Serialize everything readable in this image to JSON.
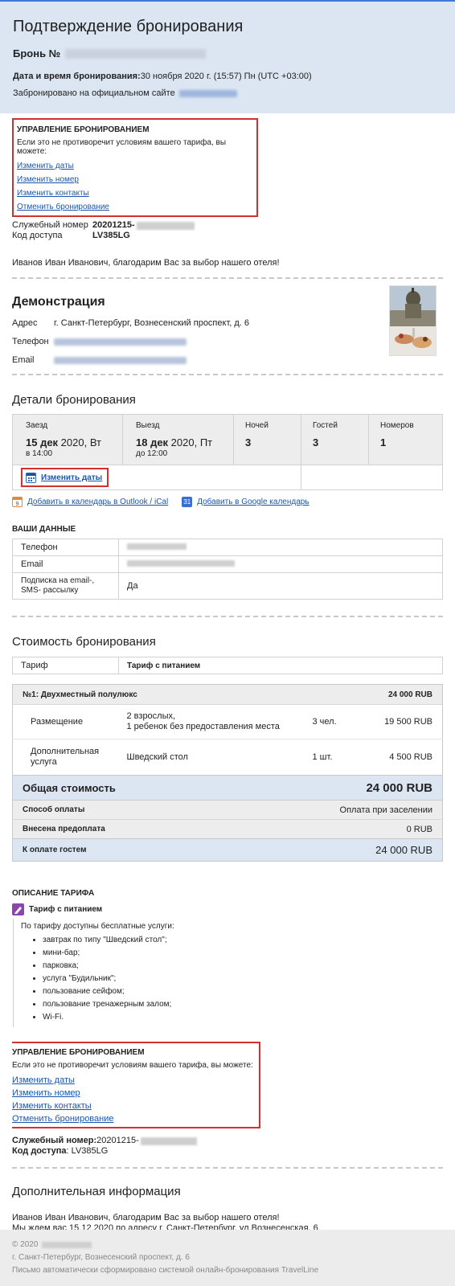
{
  "header": {
    "title": "Подтверждение бронирования",
    "booking_label": "Бронь №",
    "datetime_label": "Дата и время бронирования:",
    "datetime_value": " 30 ноября 2020 г. (15:57) Пн (UTC +03:00)",
    "booked_on": "Забронировано на официальном сайте"
  },
  "manage": {
    "title": "УПРАВЛЕНИЕ БРОНИРОВАНИЕМ",
    "subtitle": "Если это не противоречит условиям вашего тарифа, вы можете:",
    "change_dates": "Изменить даты",
    "change_room": "Изменить номер",
    "change_contacts": "Изменить контакты",
    "cancel": "Отменить бронирование"
  },
  "service": {
    "number_label": "Служебный номер",
    "number_value": "20201215-",
    "access_label": "Код доступа",
    "access_value": "LV385LG"
  },
  "greeting": "Иванов Иван Иванович, благодарим Вас за выбор нашего отеля!",
  "hotel": {
    "name": "Демонстрация",
    "address_label": "Адрес",
    "address_value": "г. Санкт-Петербург, Вознесенский проспект, д. 6",
    "phone_label": "Телефон",
    "email_label": "Email"
  },
  "details": {
    "title": "Детали бронирования",
    "checkin_label": "Заезд",
    "checkin_date": "15 дек",
    "checkin_rest": " 2020, Вт",
    "checkin_time": "в 14:00",
    "checkout_label": "Выезд",
    "checkout_date": "18 дек",
    "checkout_rest": " 2020, Пт",
    "checkout_time": "до 12:00",
    "nights_label": "Ночей",
    "nights_value": "3",
    "guests_label": "Гостей",
    "guests_value": "3",
    "rooms_label": "Номеров",
    "rooms_value": "1",
    "change_dates": "Изменить даты",
    "add_outlook": "Добавить в календарь в Outlook / iCal",
    "add_google": "Добавить в Google календарь",
    "google_icon_text": "31"
  },
  "your_data": {
    "title": "ВАШИ ДАННЫЕ",
    "phone_label": "Телефон",
    "email_label": "Email",
    "subscription_label": "Подписка на email-, SMS- рассылку",
    "subscription_value": "Да"
  },
  "cost": {
    "title": "Стоимость бронирования",
    "tariff_label": "Тариф",
    "tariff_value": "Тариф с питанием",
    "room_title": "№1: Двухместный полулюкс",
    "room_total": "24 000 RUB",
    "placement_label": "Размещение",
    "placement_desc1": "2 взрослых,",
    "placement_desc2": "1 ребенок без предоставления места",
    "placement_qty": "3 чел.",
    "placement_price": "19 500 RUB",
    "extra_label": "Дополнительная услуга",
    "extra_desc": "Шведский стол",
    "extra_qty": "1 шт.",
    "extra_price": "4 500 RUB",
    "total_label": "Общая стоимость",
    "total_value": "24 000 RUB",
    "payment_label": "Способ оплаты",
    "payment_value": "Оплата при заселении",
    "prepay_label": "Внесена предоплата",
    "prepay_value": "0 RUB",
    "due_label": "К оплате гостем",
    "due_value": "24 000 RUB"
  },
  "tariff_desc": {
    "title": "ОПИСАНИЕ ТАРИФА",
    "name": "Тариф с питанием",
    "intro": "По тарифу доступны бесплатные услуги:",
    "items": [
      "завтрак по типу \"Шведский стол\";",
      "мини-бар;",
      "парковка;",
      "услуга \"Будильник\";",
      "пользование сейфом;",
      "пользование тренажерным залом;",
      "Wi-Fi."
    ]
  },
  "service2": {
    "number_label": "Служебный номер:",
    "number_value": " 20201215-",
    "access_label": "Код доступа",
    "access_value": ": LV385LG"
  },
  "additional": {
    "title": "Дополнительная информация",
    "line1": "Иванов Иван Иванович, благодарим Вас за выбор нашего отеля!",
    "line2": "Мы ждем вас 15.12.2020 по адресу г. Санкт-Петербург, ул.Вознесенская, 6."
  },
  "footer": {
    "copyright": "© 2020",
    "address": "г. Санкт-Петербург, Вознесенский проспект, д. 6",
    "generated": "Письмо автоматически сформировано системой онлайн-бронирования TravelLine"
  },
  "colors": {
    "header_bg": "#dce6f3",
    "link": "#1a56b0",
    "highlight_border": "#d32f2f",
    "total_row_bg": "#dce6f3"
  }
}
